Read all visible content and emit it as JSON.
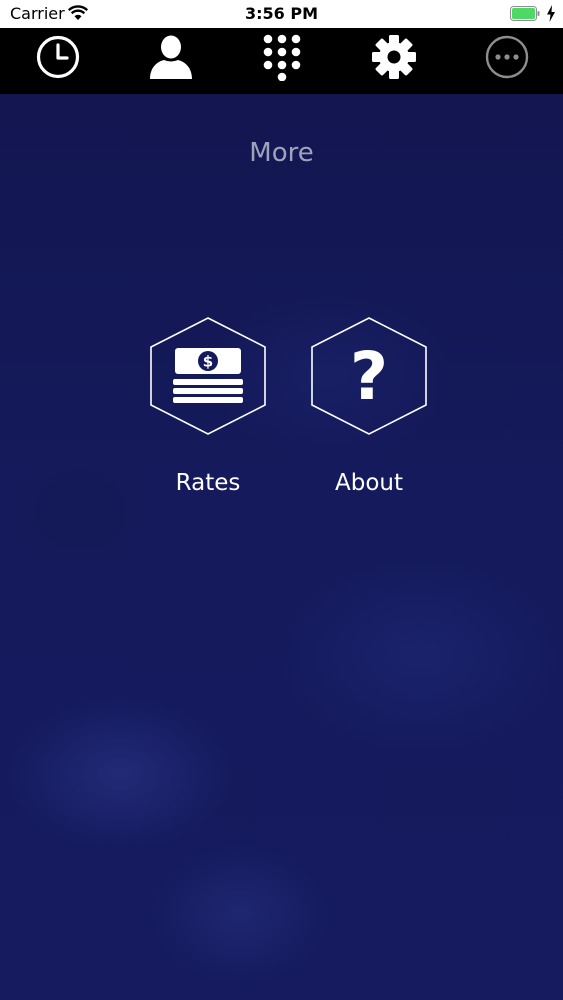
{
  "status_bar": {
    "carrier": "Carrier",
    "time": "3:56 PM",
    "battery_color": "#4cd964"
  },
  "nav_bar": {
    "items": [
      {
        "icon": "clock-icon"
      },
      {
        "icon": "user-icon"
      },
      {
        "icon": "keypad-icon"
      },
      {
        "icon": "gear-icon"
      },
      {
        "icon": "more-icon"
      }
    ]
  },
  "page": {
    "title": "More",
    "tiles": [
      {
        "label": "Rates",
        "icon": "money-icon"
      },
      {
        "label": "About",
        "icon": "question-icon"
      }
    ]
  },
  "colors": {
    "background": "#141a5c",
    "nav_background": "#000000",
    "title": "#9da3bd",
    "text": "#ffffff"
  }
}
